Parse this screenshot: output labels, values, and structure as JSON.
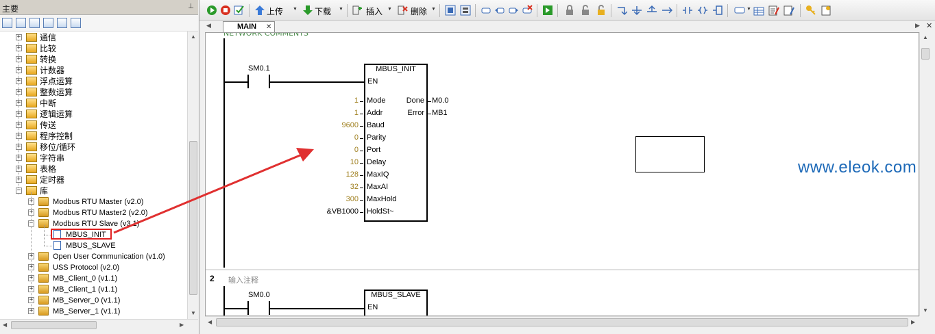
{
  "left_pane": {
    "title": "主要",
    "categories": [
      "通信",
      "比较",
      "转换",
      "计数器",
      "浮点运算",
      "整数运算",
      "中断",
      "逻辑运算",
      "传送",
      "程序控制",
      "移位/循环",
      "字符串",
      "表格",
      "定时器",
      "库"
    ],
    "libraries": [
      {
        "label": "Modbus RTU Master (v2.0)"
      },
      {
        "label": "Modbus RTU Master2 (v2.0)"
      },
      {
        "label": "Modbus RTU Slave (v3.1)",
        "children": [
          "MBUS_INIT",
          "MBUS_SLAVE"
        ]
      },
      {
        "label": "Open User Communication (v1.0)"
      },
      {
        "label": "USS Protocol (v2.0)"
      },
      {
        "label": "MB_Client_0 (v1.1)"
      },
      {
        "label": "MB_Client_1 (v1.1)"
      },
      {
        "label": "MB_Server_0 (v1.1)"
      },
      {
        "label": "MB_Server_1 (v1.1)"
      }
    ]
  },
  "toolbar": {
    "upload": "上传",
    "download": "下载",
    "insert": "插入",
    "delete": "删除"
  },
  "tabs": [
    {
      "label": "MAIN"
    }
  ],
  "editor": {
    "network1": {
      "comment": "NETWORK COMMENTS",
      "contact": "SM0.1",
      "block": "MBUS_INIT",
      "en": "EN",
      "inputs": [
        {
          "pin": "Mode",
          "value": "1"
        },
        {
          "pin": "Addr",
          "value": "1"
        },
        {
          "pin": "Baud",
          "value": "9600"
        },
        {
          "pin": "Parity",
          "value": "0"
        },
        {
          "pin": "Port",
          "value": "0"
        },
        {
          "pin": "Delay",
          "value": "10"
        },
        {
          "pin": "MaxIQ",
          "value": "128"
        },
        {
          "pin": "MaxAI",
          "value": "32"
        },
        {
          "pin": "MaxHold",
          "value": "300"
        },
        {
          "pin": "HoldSt~",
          "value": "&VB1000"
        }
      ],
      "outputs": [
        {
          "pin": "Done",
          "value": "M0.0"
        },
        {
          "pin": "Error",
          "value": "MB1"
        }
      ]
    },
    "network2": {
      "number": "2",
      "comment": "输入注释",
      "contact": "SM0.0",
      "block": "MBUS_SLAVE",
      "en": "EN"
    }
  },
  "watermark": "www.eleok.com",
  "colors": {
    "selection": "#e02020",
    "watermark": "#1e6ab8",
    "value_text": "#a08020"
  }
}
